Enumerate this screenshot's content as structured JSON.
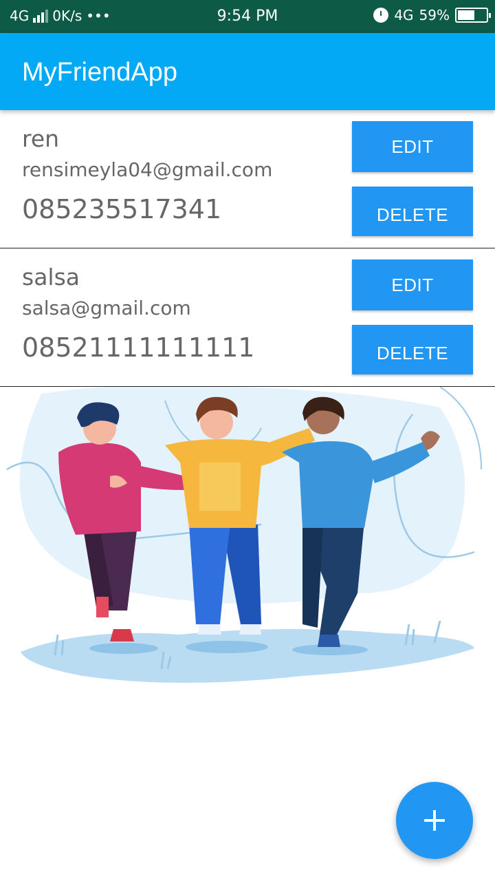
{
  "status_bar": {
    "network_left": "4G",
    "speed": "0K/s",
    "more": "•••",
    "time": "9:54 PM",
    "network_right": "4G",
    "battery": "59%",
    "battery_level": 0.59
  },
  "app_bar": {
    "title": "MyFriendApp"
  },
  "friends": [
    {
      "name": "ren",
      "email": "rensimeyla04@gmail.com",
      "phone": "085235517341",
      "edit_label": "EDIT",
      "delete_label": "DELETE"
    },
    {
      "name": "salsa",
      "email": "salsa@gmail.com",
      "phone": "08521111111111",
      "edit_label": "EDIT",
      "delete_label": "DELETE"
    }
  ],
  "colors": {
    "status_bar": "#0d5a47",
    "app_bar": "#03a9f4",
    "button": "#2196f3",
    "fab": "#2196f3"
  },
  "illustration": {
    "icon": "three-friends-illustration"
  },
  "fab": {
    "icon": "plus-icon"
  }
}
